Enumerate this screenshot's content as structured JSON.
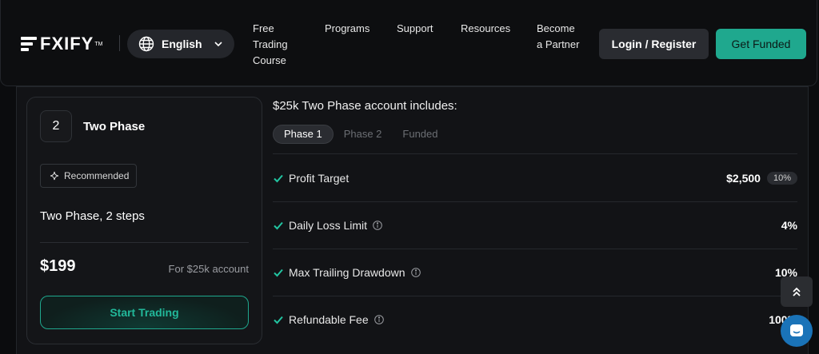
{
  "header": {
    "logo_text": "FXIFY",
    "logo_tm": "TM",
    "language": "English",
    "nav": [
      {
        "id": "free-trading-course",
        "lines": [
          "Free",
          "Trading",
          "Course"
        ]
      },
      {
        "id": "programs",
        "lines": [
          "Programs"
        ]
      },
      {
        "id": "support",
        "lines": [
          "Support"
        ]
      },
      {
        "id": "resources",
        "lines": [
          "Resources"
        ]
      },
      {
        "id": "become-partner",
        "lines": [
          "Become",
          "a Partner"
        ]
      }
    ],
    "login_label": "Login / Register",
    "get_funded_label": "Get Funded"
  },
  "card": {
    "step_number": "2",
    "title": "Two Phase",
    "badge": "Recommended",
    "subtitle": "Two Phase, 2 steps",
    "price": "$199",
    "price_note": "For $25k account",
    "cta": "Start Trading"
  },
  "details": {
    "title": "$25k Two Phase account includes:",
    "tabs": [
      {
        "label": "Phase 1",
        "active": true
      },
      {
        "label": "Phase 2",
        "active": false
      },
      {
        "label": "Funded",
        "active": false
      }
    ],
    "rows": [
      {
        "label": "Profit Target",
        "value": "$2,500",
        "badge": "10%",
        "info": false
      },
      {
        "label": "Daily Loss Limit",
        "value": "4%",
        "info": true
      },
      {
        "label": "Max Trailing Drawdown",
        "value": "10%",
        "info": true
      },
      {
        "label": "Refundable Fee",
        "value": "100%",
        "info": true
      }
    ]
  },
  "colors": {
    "accent": "#1fa88e",
    "check": "#22c4a1",
    "chat": "#1a73b8"
  }
}
